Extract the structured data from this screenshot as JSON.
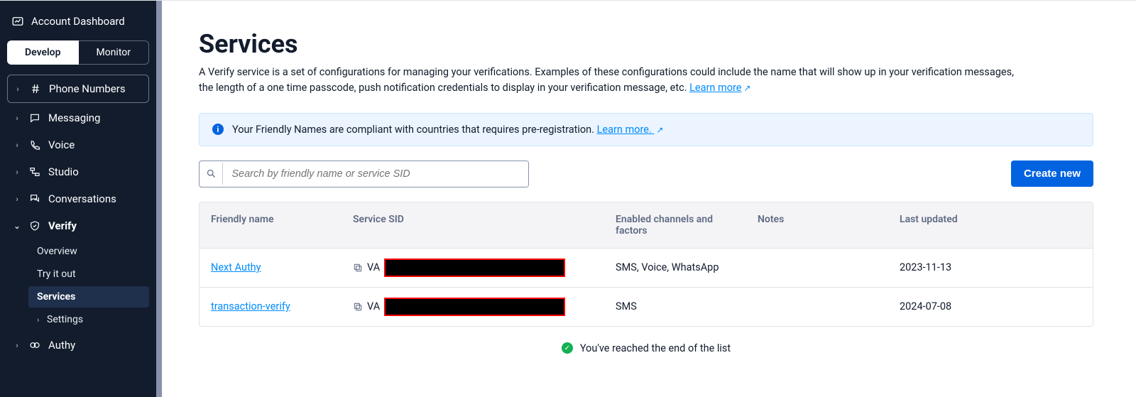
{
  "sidebar": {
    "dashboard": "Account Dashboard",
    "tabs": {
      "develop": "Develop",
      "monitor": "Monitor"
    },
    "items": [
      {
        "label": "Phone Numbers"
      },
      {
        "label": "Messaging"
      },
      {
        "label": "Voice"
      },
      {
        "label": "Studio"
      },
      {
        "label": "Conversations"
      },
      {
        "label": "Verify"
      },
      {
        "label": "Authy"
      }
    ],
    "verify_sub": [
      {
        "label": "Overview"
      },
      {
        "label": "Try it out"
      },
      {
        "label": "Services"
      },
      {
        "label": "Settings"
      }
    ]
  },
  "page": {
    "title": "Services",
    "desc_a": "A Verify service is a set of configurations for managing your verifications. Examples of these configurations could include the name that will show up in your verification messages, the length of a one time passcode, push notification credentials to display in your verification message, etc. ",
    "learn_more": "Learn more"
  },
  "banner": {
    "text": "Your Friendly Names are compliant with countries that requires pre-registration. ",
    "link": "Learn more."
  },
  "search": {
    "placeholder": "Search by friendly name or service SID"
  },
  "create_button": "Create new",
  "table": {
    "headers": [
      "Friendly name",
      "Service SID",
      "Enabled channels and factors",
      "Notes",
      "Last updated"
    ],
    "rows": [
      {
        "name": "Next Authy",
        "sid_prefix": "VA",
        "channels": "SMS, Voice, WhatsApp",
        "notes": "",
        "updated": "2023-11-13"
      },
      {
        "name": "transaction-verify",
        "sid_prefix": "VA",
        "channels": "SMS",
        "notes": "",
        "updated": "2024-07-08"
      }
    ]
  },
  "end_text": "You've reached the end of the list"
}
